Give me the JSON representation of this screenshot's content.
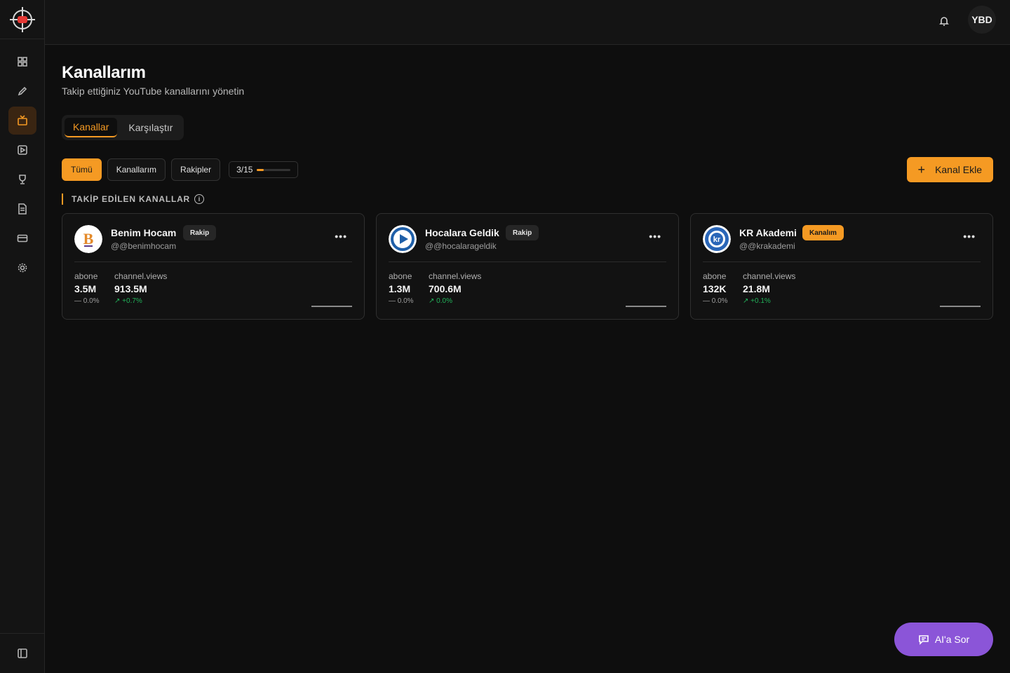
{
  "user": {
    "initials": "YBD"
  },
  "page": {
    "title": "Kanallarım",
    "subtitle": "Takip ettiğiniz YouTube kanallarını yönetin"
  },
  "tabs": [
    {
      "label": "Kanallar",
      "active": true
    },
    {
      "label": "Karşılaştır",
      "active": false
    }
  ],
  "filters": [
    {
      "label": "Tümü",
      "active": true
    },
    {
      "label": "Kanallarım",
      "active": false
    },
    {
      "label": "Rakipler",
      "active": false
    }
  ],
  "quota": {
    "label": "3/15",
    "used": 3,
    "total": 15
  },
  "add_button": {
    "label": "Kanal Ekle"
  },
  "section": {
    "title": "TAKİP EDİLEN KANALLAR"
  },
  "channels": [
    {
      "name": "Benim Hocam",
      "handle": "@@benimhocam",
      "badge": "Rakip",
      "subs_label": "abone",
      "subs_value": "3.5M",
      "subs_change": "0.0%",
      "views_label": "channel.views",
      "views_value": "913.5M",
      "views_change": "+0.7%"
    },
    {
      "name": "Hocalara Geldik",
      "handle": "@@hocalarageldik",
      "badge": "Rakip",
      "subs_label": "abone",
      "subs_value": "1.3M",
      "subs_change": "0.0%",
      "views_label": "channel.views",
      "views_value": "700.6M",
      "views_change": "0.0%"
    },
    {
      "name": "KR Akademi",
      "handle": "@@krakademi",
      "badge": "Kanalım",
      "subs_label": "abone",
      "subs_value": "132K",
      "subs_change": "0.0%",
      "views_label": "channel.views",
      "views_value": "21.8M",
      "views_change": "+0.1%"
    }
  ],
  "ai_button": {
    "label": "AI'a Sor"
  },
  "colors": {
    "accent": "#f59a23",
    "ai": "#8b55d8",
    "positive": "#22b35a"
  }
}
